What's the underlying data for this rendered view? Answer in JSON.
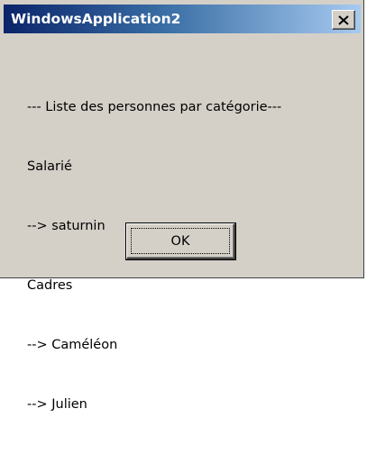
{
  "window": {
    "title": "WindowsApplication2",
    "close_icon": "close-icon"
  },
  "message": {
    "lines": [
      "--- Liste des personnes par catégorie---",
      "Salarié",
      "--> saturnin",
      "Cadres",
      "--> Caméléon",
      "--> Julien"
    ]
  },
  "buttons": {
    "ok_label": "OK"
  },
  "colors": {
    "titlebar_start": "#0a246a",
    "titlebar_end": "#a6caf0",
    "window_face": "#d4d0c8"
  }
}
